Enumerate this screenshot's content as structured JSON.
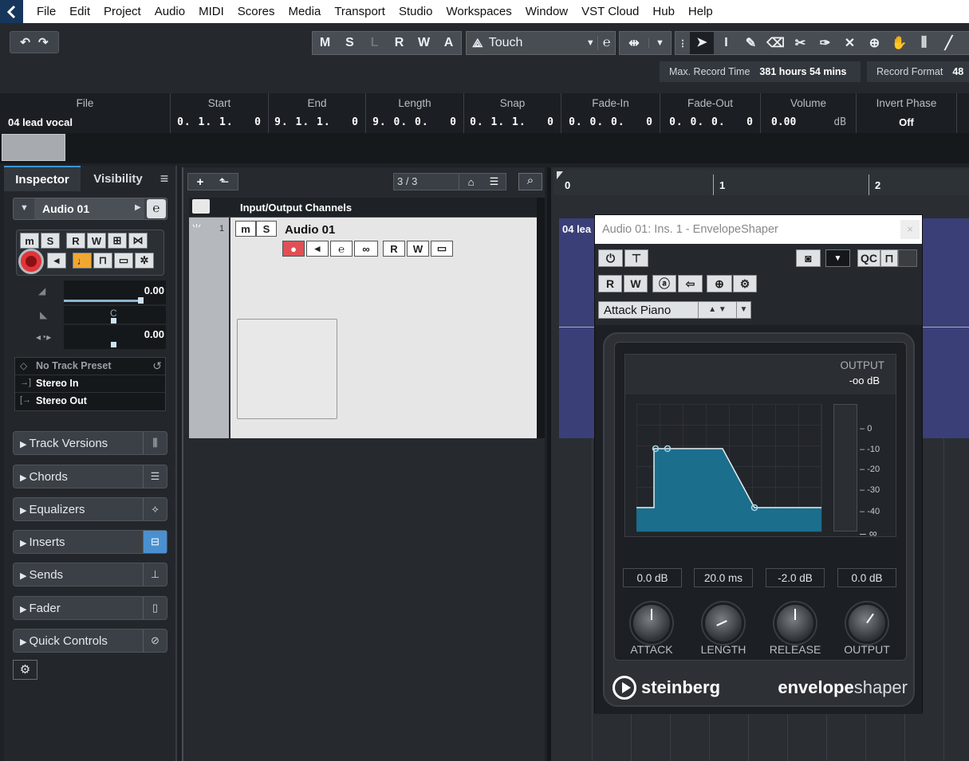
{
  "menu": [
    "File",
    "Edit",
    "Project",
    "Audio",
    "MIDI",
    "Scores",
    "Media",
    "Transport",
    "Studio",
    "Workspaces",
    "Window",
    "VST Cloud",
    "Hub",
    "Help"
  ],
  "toolbar": {
    "automation_buttons": [
      "M",
      "S",
      "L",
      "R",
      "W",
      "A"
    ],
    "automation_mode": "Touch",
    "max_record_label": "Max. Record Time",
    "max_record_value": "381 hours 54 mins",
    "record_format_label": "Record Format",
    "record_format_value": "48"
  },
  "infoline": {
    "file_label": "File",
    "file_value": "04 lead vocal",
    "start_label": "Start",
    "start_value": "0. 1. 1.   0",
    "end_label": "End",
    "end_value": "9. 1. 1.   0",
    "length_label": "Length",
    "length_value": "9. 0. 0.   0",
    "snap_label": "Snap",
    "snap_value": "0. 1. 1.   0",
    "fadein_label": "Fade-In",
    "fadein_value": "0. 0. 0.   0",
    "fadeout_label": "Fade-Out",
    "fadeout_value": "0. 0. 0.   0",
    "volume_label": "Volume",
    "volume_value": "0.00",
    "volume_unit": "dB",
    "invert_label": "Invert Phase",
    "invert_value": "Off"
  },
  "inspector": {
    "tab_inspector": "Inspector",
    "tab_visibility": "Visibility",
    "track_name": "Audio 01",
    "volume_value": "0.00",
    "pan_value": "C",
    "delay_value": "0.00",
    "preset": "No Track Preset",
    "input": "Stereo In",
    "output": "Stereo Out",
    "sections": [
      "Track Versions",
      "Chords",
      "Equalizers",
      "Inserts",
      "Sends",
      "Fader",
      "Quick Controls"
    ]
  },
  "tracklist": {
    "counter": "3 / 3",
    "folder_name": "Input/Output Channels",
    "track_number": "1",
    "track_name": "Audio 01"
  },
  "ruler": {
    "marks": [
      "0",
      "1",
      "2"
    ]
  },
  "event_label": "04 lea",
  "plugin": {
    "title": "Audio 01: Ins. 1 - EnvelopeShaper",
    "preset": "Attack Piano",
    "qc_label": "QC",
    "output_label": "OUTPUT",
    "output_value": "-oo dB",
    "meter_scale": [
      "0",
      "-10",
      "-20",
      "-30",
      "-40",
      "∞"
    ],
    "params": [
      {
        "name": "ATTACK",
        "value": "0.0 dB"
      },
      {
        "name": "LENGTH",
        "value": "20.0 ms"
      },
      {
        "name": "RELEASE",
        "value": "-2.0 dB"
      },
      {
        "name": "OUTPUT",
        "value": "0.0 dB"
      }
    ],
    "brand": "steinberg",
    "product_bold": "envelope",
    "product_light": "shaper"
  },
  "colors": {
    "accent_blue": "#1b6e8c",
    "record_red": "#e0353a",
    "monitor_orange": "#f0a830"
  }
}
